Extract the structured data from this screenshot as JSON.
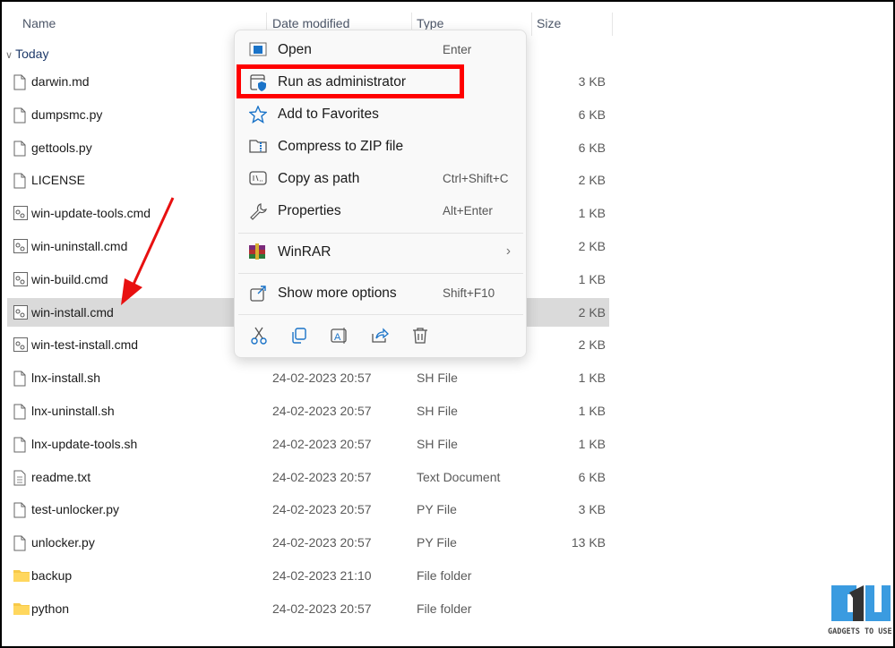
{
  "columns": {
    "name": "Name",
    "date": "Date modified",
    "type": "Type",
    "size": "Size"
  },
  "group": "Today",
  "files": [
    {
      "name": "darwin.md",
      "date": "",
      "type": "",
      "size": "3 KB",
      "icon": "file-icon"
    },
    {
      "name": "dumpsmc.py",
      "date": "",
      "type": "",
      "size": "6 KB",
      "icon": "file-icon"
    },
    {
      "name": "gettools.py",
      "date": "",
      "type": "",
      "size": "6 KB",
      "icon": "file-icon"
    },
    {
      "name": "LICENSE",
      "date": "",
      "type": "",
      "size": "2 KB",
      "icon": "file-icon"
    },
    {
      "name": "win-update-tools.cmd",
      "date": "",
      "type": "",
      "size": "1 KB",
      "icon": "cmd-icon"
    },
    {
      "name": "win-uninstall.cmd",
      "date": "",
      "type": "",
      "size": "2 KB",
      "icon": "cmd-icon"
    },
    {
      "name": "win-build.cmd",
      "date": "",
      "type": "",
      "size": "1 KB",
      "icon": "cmd-icon"
    },
    {
      "name": "win-install.cmd",
      "date": "",
      "type": "",
      "size": "2 KB",
      "icon": "cmd-icon"
    },
    {
      "name": "win-test-install.cmd",
      "date": "",
      "type": "",
      "size": "2 KB",
      "icon": "cmd-icon"
    },
    {
      "name": "lnx-install.sh",
      "date": "24-02-2023 20:57",
      "type": "SH File",
      "size": "1 KB",
      "icon": "file-icon"
    },
    {
      "name": "lnx-uninstall.sh",
      "date": "24-02-2023 20:57",
      "type": "SH File",
      "size": "1 KB",
      "icon": "file-icon"
    },
    {
      "name": "lnx-update-tools.sh",
      "date": "24-02-2023 20:57",
      "type": "SH File",
      "size": "1 KB",
      "icon": "file-icon"
    },
    {
      "name": "readme.txt",
      "date": "24-02-2023 20:57",
      "type": "Text Document",
      "size": "6 KB",
      "icon": "text-icon"
    },
    {
      "name": "test-unlocker.py",
      "date": "24-02-2023 20:57",
      "type": "PY File",
      "size": "3 KB",
      "icon": "file-icon"
    },
    {
      "name": "unlocker.py",
      "date": "24-02-2023 20:57",
      "type": "PY File",
      "size": "13 KB",
      "icon": "file-icon"
    },
    {
      "name": "backup",
      "date": "24-02-2023 21:10",
      "type": "File folder",
      "size": "",
      "icon": "folder-icon"
    },
    {
      "name": "python",
      "date": "24-02-2023 20:57",
      "type": "File folder",
      "size": "",
      "icon": "folder-icon"
    }
  ],
  "menu": {
    "items": [
      {
        "label": "Open",
        "shortcut": "Enter",
        "icon": "open-icon"
      },
      {
        "label": "Run as administrator",
        "shortcut": "",
        "icon": "shield-icon"
      },
      {
        "label": "Add to Favorites",
        "shortcut": "",
        "icon": "star-icon"
      },
      {
        "label": "Compress to ZIP file",
        "shortcut": "",
        "icon": "zip-icon"
      },
      {
        "label": "Copy as path",
        "shortcut": "Ctrl+Shift+C",
        "icon": "path-icon"
      },
      {
        "label": "Properties",
        "shortcut": "Alt+Enter",
        "icon": "wrench-icon"
      }
    ],
    "winrar": "WinRAR",
    "more": {
      "label": "Show more options",
      "shortcut": "Shift+F10"
    },
    "bottom_icons": [
      "cut-icon",
      "copy-icon",
      "rename-icon",
      "share-icon",
      "delete-icon"
    ]
  },
  "accent": "#1a73c8",
  "highlight_color": "#ff0000",
  "watermark": "GADGETS TO USE"
}
